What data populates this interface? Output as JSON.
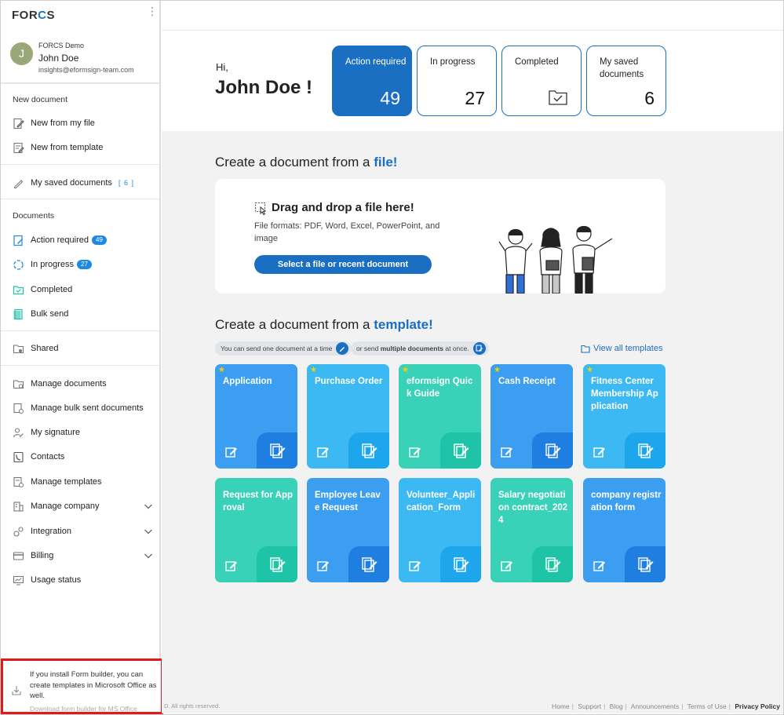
{
  "app": {
    "logo_left": "FOR",
    "logo_accent": "C",
    "logo_right": "S"
  },
  "profile": {
    "initial": "J",
    "org": "FORCS Demo",
    "name": "John Doe",
    "email": "insights@eformsign-team.com"
  },
  "sidebar": {
    "new_document_label": "New document",
    "new_from_file": "New from my file",
    "new_from_template": "New from template",
    "my_saved_documents": "My saved documents",
    "my_saved_count": "[ 6 ]",
    "documents_label": "Documents",
    "action_required": "Action required",
    "action_required_count": "49",
    "in_progress": "In progress",
    "in_progress_count": "27",
    "completed": "Completed",
    "bulk_send": "Bulk send",
    "shared": "Shared",
    "manage_documents": "Manage documents",
    "manage_bulk": "Manage bulk sent documents",
    "my_signature": "My signature",
    "contacts": "Contacts",
    "manage_templates": "Manage templates",
    "manage_company": "Manage company",
    "integration": "Integration",
    "billing": "Billing",
    "usage_status": "Usage status"
  },
  "promo": {
    "text": "If you install Form builder, you can create templates in Microsoft Office as well.",
    "link": "Download form builder for MS Office"
  },
  "greeting": {
    "hi": "Hi,",
    "name": "John Doe !"
  },
  "stats": [
    {
      "label": "Action required",
      "value": "49"
    },
    {
      "label": "In progress",
      "value": "27"
    },
    {
      "label": "Completed",
      "value": ""
    },
    {
      "label": "My saved documents",
      "value": "6"
    }
  ],
  "file_section": {
    "heading_prefix": "Create a document from a ",
    "heading_highlight": "file!",
    "drop_title": "Drag and drop a file here!",
    "drop_desc": "File formats: PDF, Word, Excel, PowerPoint, and image",
    "select_button": "Select a file or recent document"
  },
  "template_section": {
    "heading_prefix": "Create a document from a ",
    "heading_highlight": "template!",
    "pill_one": "You can send one document at a time",
    "pill_multi_prefix": "or send ",
    "pill_multi_bold": "multiple documents",
    "pill_multi_suffix": " at once.",
    "view_all": "View all templates",
    "templates": [
      {
        "title": "Application",
        "starred": true
      },
      {
        "title": "Purchase Order",
        "starred": true
      },
      {
        "title": "eformsign Quick Guide",
        "starred": true
      },
      {
        "title": "Cash Receipt",
        "starred": true
      },
      {
        "title": "Fitness Center Membership Application",
        "starred": true
      },
      {
        "title": "Request for Approval",
        "starred": false
      },
      {
        "title": "Employee Leave Request",
        "starred": false
      },
      {
        "title": "Volunteer_Application_Form",
        "starred": false
      },
      {
        "title": "Salary negotiation contract_2024",
        "starred": false
      },
      {
        "title": "company registration form",
        "starred": false
      }
    ]
  },
  "footer": {
    "copyright": "D. All rights reserved.",
    "links": [
      "Home",
      "Support",
      "Blog",
      "Announcements",
      "Terms of Use"
    ],
    "privacy": "Privacy Policy"
  },
  "colors": {
    "brand": "#1a6fc2",
    "badge": "#1e88e5",
    "promo_border": "#e0191e"
  }
}
